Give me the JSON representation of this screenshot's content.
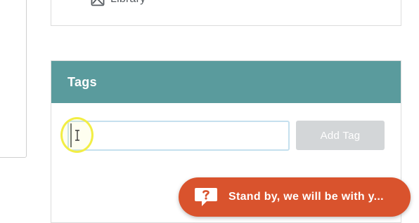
{
  "library": {
    "label": "Library",
    "icon": "image-icon"
  },
  "tags_panel": {
    "title": "Tags",
    "input": {
      "value": "",
      "placeholder": ""
    },
    "add_button_label": "Add Tag"
  },
  "chat": {
    "icon": "chat-question-icon",
    "text": "Stand by, we will be with y..."
  },
  "colors": {
    "tags_header": "#5a9b9d",
    "chat_banner": "#d9532d",
    "add_button_disabled": "#d3d6d8",
    "input_focus_border": "#c5e0ee",
    "click_highlight": "#f2ee44"
  }
}
